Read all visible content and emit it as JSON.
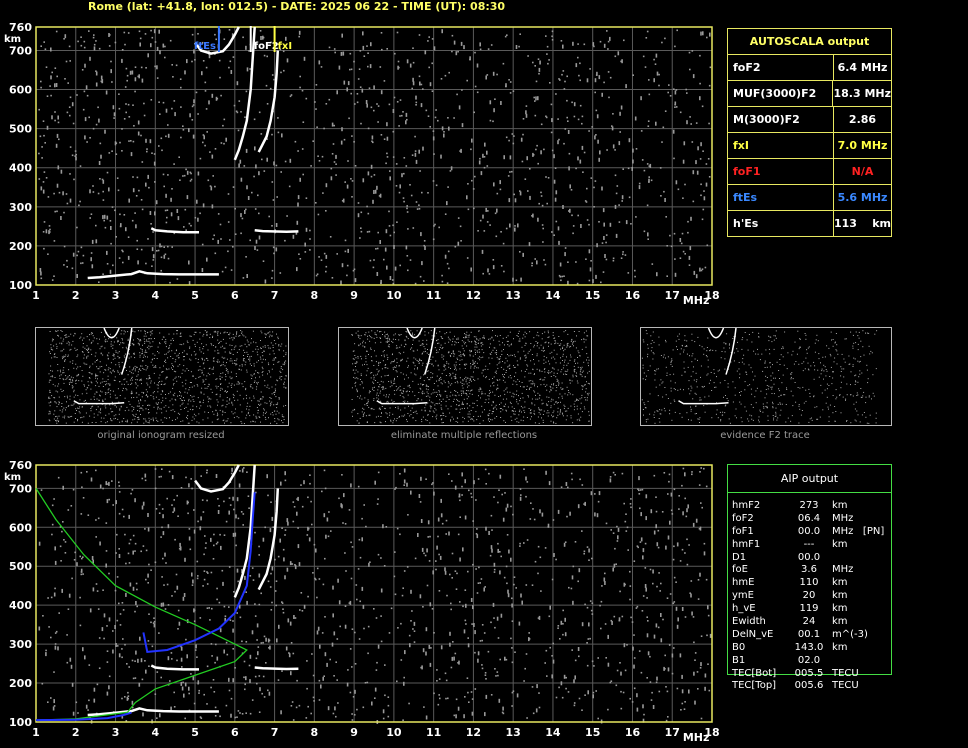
{
  "header": {
    "title": "Rome (lat: +41.8, lon: 012.5) - DATE: 2025 06 22 - TIME (UT): 08:30"
  },
  "colors": {
    "axis": "#e8e860",
    "grid": "#5a5a5a",
    "noise": "#9a9a9a",
    "trace": "#ffffff",
    "ftEs": "#3a78ff",
    "foF2": "#ffffff",
    "fxI": "#ffff44",
    "model": "#22cc22",
    "profile": "#2233ff"
  },
  "top_chart": {
    "y_unit": "km",
    "x_unit": "MHz",
    "x_ticks": [
      "1",
      "2",
      "3",
      "4",
      "5",
      "6",
      "7",
      "8",
      "9",
      "10",
      "11",
      "12",
      "13",
      "14",
      "15",
      "16",
      "17",
      "18"
    ],
    "y_ticks": [
      "760",
      "700",
      "600",
      "500",
      "400",
      "300",
      "200",
      "100"
    ],
    "markers": [
      {
        "label": "ftEs",
        "freq": 5.6,
        "color": "#3a78ff"
      },
      {
        "label": "foF2",
        "freq": 6.4,
        "color": "#ffffff"
      },
      {
        "label": "fxI",
        "freq": 7.0,
        "color": "#ffff44"
      }
    ]
  },
  "chart_data": [
    {
      "type": "scatter",
      "title": "",
      "xlabel": "MHz",
      "ylabel": "km",
      "xlim": [
        1,
        18
      ],
      "ylim": [
        100,
        760
      ],
      "series": [
        {
          "values": [
            [
              2.3,
              118
            ],
            [
              2.6,
              120
            ],
            [
              3.0,
              124
            ],
            [
              3.4,
              128
            ],
            [
              3.6,
              135
            ],
            [
              3.8,
              130
            ],
            [
              4.2,
              128
            ],
            [
              4.6,
              127
            ],
            [
              5.0,
              127
            ],
            [
              5.6,
              127
            ]
          ]
        },
        {
          "values": [
            [
              3.9,
              245
            ],
            [
              4.0,
              240
            ],
            [
              4.3,
              237
            ],
            [
              4.7,
              235
            ],
            [
              5.1,
              235
            ]
          ]
        },
        {
          "values": [
            [
              6.5,
              240
            ],
            [
              6.7,
              238
            ],
            [
              7.3,
              236
            ],
            [
              7.6,
              237
            ]
          ]
        },
        {
          "values": [
            [
              5.0,
              720
            ],
            [
              5.15,
              700
            ],
            [
              5.4,
              692
            ],
            [
              5.7,
              698
            ],
            [
              5.85,
              715
            ],
            [
              6.0,
              740
            ],
            [
              6.1,
              760
            ]
          ]
        },
        {
          "values": [
            [
              6.0,
              420
            ],
            [
              6.1,
              445
            ],
            [
              6.2,
              480
            ],
            [
              6.3,
              520
            ],
            [
              6.4,
              600
            ],
            [
              6.45,
              680
            ],
            [
              6.5,
              760
            ]
          ]
        },
        {
          "values": [
            [
              6.6,
              440
            ],
            [
              6.8,
              480
            ],
            [
              6.9,
              520
            ],
            [
              7.0,
              580
            ],
            [
              7.05,
              640
            ],
            [
              7.08,
              700
            ]
          ]
        }
      ]
    },
    {
      "type": "line",
      "title": "",
      "xlabel": "MHz",
      "ylabel": "km",
      "xlim": [
        1,
        18
      ],
      "ylim": [
        100,
        760
      ],
      "series": [
        {
          "values": [
            [
              1.0,
              700
            ],
            [
              1.5,
              620
            ],
            [
              2.2,
              530
            ],
            [
              3.0,
              450
            ],
            [
              4.0,
              395
            ],
            [
              5.0,
              350
            ],
            [
              5.8,
              310
            ],
            [
              6.3,
              285
            ],
            [
              6.0,
              255
            ],
            [
              5.0,
              220
            ],
            [
              4.0,
              185
            ],
            [
              3.5,
              150
            ],
            [
              3.3,
              125
            ],
            [
              2.0,
              108
            ],
            [
              1.0,
              105
            ]
          ]
        },
        {
          "values": [
            [
              3.7,
              330
            ],
            [
              3.8,
              280
            ],
            [
              4.3,
              285
            ],
            [
              5.0,
              310
            ],
            [
              5.6,
              340
            ],
            [
              6.0,
              380
            ],
            [
              6.3,
              450
            ],
            [
              6.4,
              540
            ],
            [
              6.45,
              620
            ],
            [
              6.5,
              690
            ]
          ]
        },
        {
          "values": [
            [
              1.0,
              105
            ],
            [
              2.0,
              106
            ],
            [
              2.8,
              110
            ],
            [
              3.2,
              118
            ],
            [
              3.4,
              124
            ]
          ]
        }
      ]
    }
  ],
  "thumbs": [
    {
      "caption": "original ionogram resized"
    },
    {
      "caption": "eliminate multiple reflections"
    },
    {
      "caption": "evidence F2 trace"
    }
  ],
  "autoscala": {
    "title": "AUTOSCALA output",
    "rows": [
      {
        "label": "foF2",
        "value": "6.4 MHz",
        "color": "#ffffff"
      },
      {
        "label": "MUF(3000)F2",
        "value": "18.3 MHz",
        "color": "#ffffff"
      },
      {
        "label": "M(3000)F2",
        "value": "2.86",
        "color": "#ffffff"
      },
      {
        "label": "fxI",
        "value": "7.0 MHz",
        "color": "#ffff44"
      },
      {
        "label": "foF1",
        "value": "N/A",
        "color": "#ff2222"
      },
      {
        "label": "ftEs",
        "value": "5.6 MHz",
        "color": "#3a88ff"
      },
      {
        "label": "h'Es",
        "value": "113    km",
        "color": "#ffffff"
      }
    ]
  },
  "aip": {
    "title": "AIP output",
    "rows": [
      {
        "name": "hmF2",
        "value": "273",
        "unit": "km"
      },
      {
        "name": "foF2",
        "value": "06.4",
        "unit": "MHz"
      },
      {
        "name": "foF1",
        "value": "00.0",
        "unit": "MHz   [PN]"
      },
      {
        "name": "hmF1",
        "value": "---",
        "unit": "km"
      },
      {
        "name": "D1",
        "value": "00.0",
        "unit": ""
      },
      {
        "name": "foE",
        "value": "3.6",
        "unit": "MHz"
      },
      {
        "name": "hmE",
        "value": "110",
        "unit": "km"
      },
      {
        "name": "ymE",
        "value": "20",
        "unit": "km"
      },
      {
        "name": "h_vE",
        "value": "119",
        "unit": "km"
      },
      {
        "name": "Ewidth",
        "value": "24",
        "unit": "km"
      },
      {
        "name": "DelN_vE",
        "value": "00.1",
        "unit": "m^(-3)"
      },
      {
        "name": "B0",
        "value": "143.0",
        "unit": "km"
      },
      {
        "name": "B1",
        "value": "02.0",
        "unit": ""
      },
      {
        "name": "TEC[Bot]",
        "value": "005.5",
        "unit": "TECU"
      },
      {
        "name": "TEC[Top]",
        "value": "005.6",
        "unit": "TECU"
      }
    ]
  }
}
